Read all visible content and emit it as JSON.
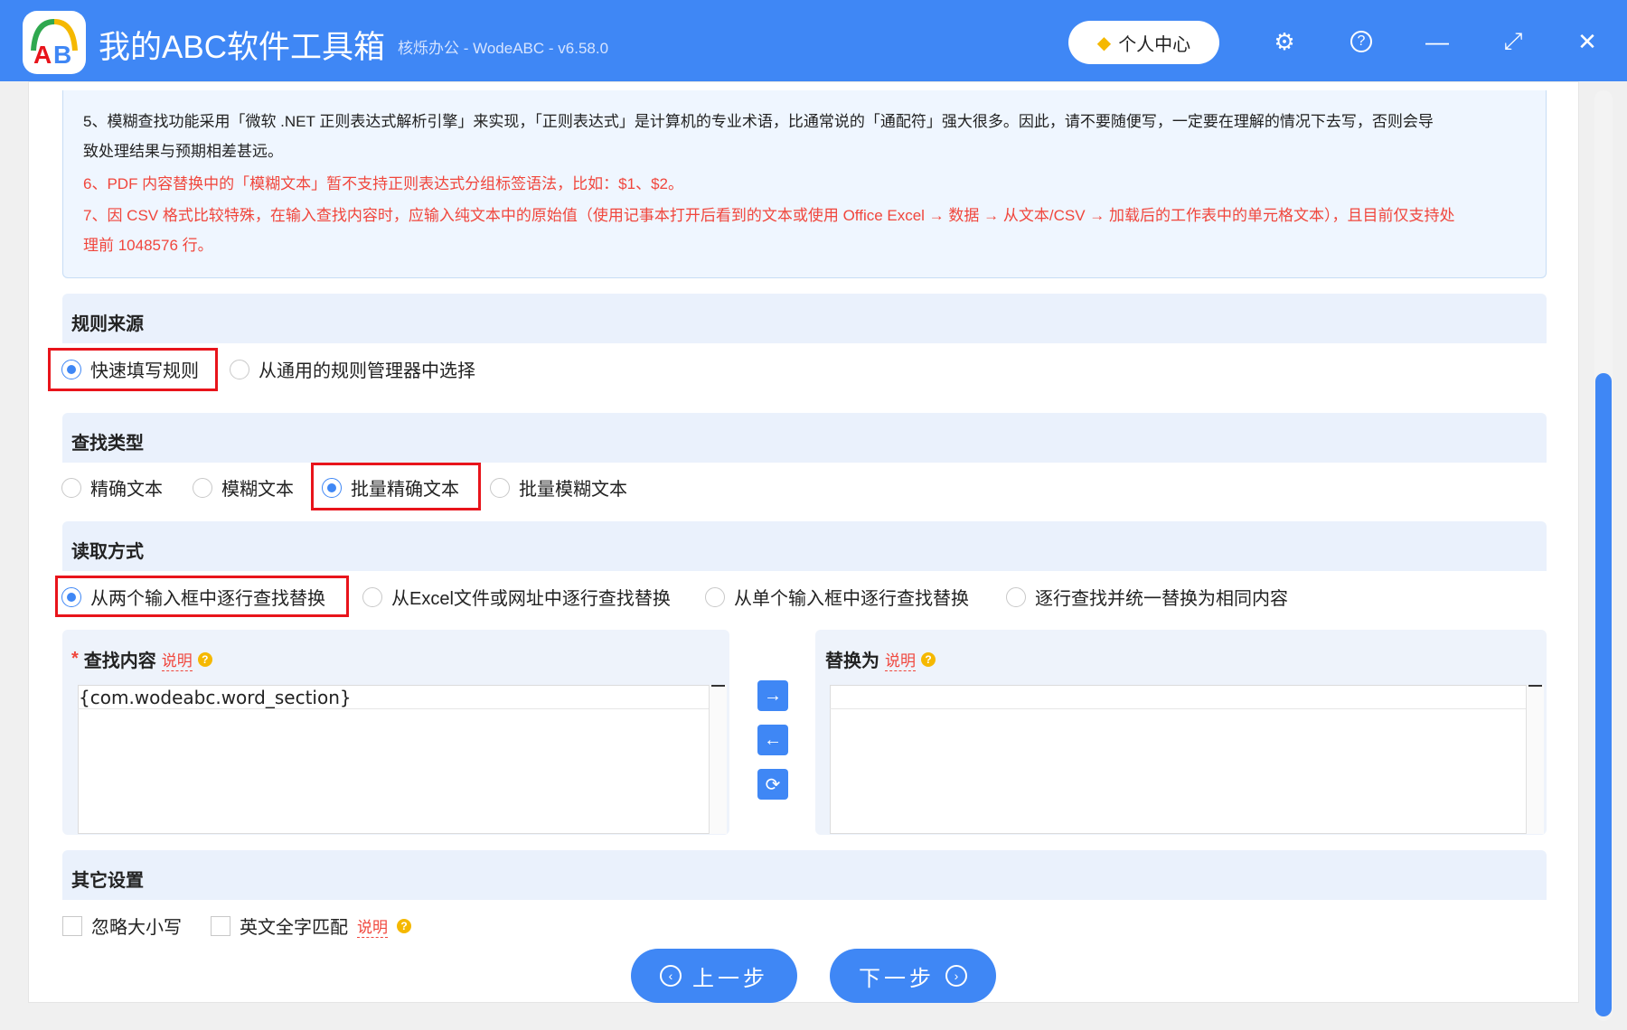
{
  "app": {
    "title": "我的ABC软件工具箱",
    "subtitle": "核烁办公 - WodeABC - v6.58.0",
    "user_center": "个人中心",
    "accent": "#3f87f5"
  },
  "info": {
    "lines": [
      "5、模糊查找功能采用「微软 .NET 正则表达式解析引擎」来实现，「正则表达式」是计算机的专业术语，比通常说的「通配符」强大很多。因此，请不要随便写，一定要在理解的情况下去写，否则会导",
      "致处理结果与预期相差甚远。",
      "6、PDF 内容替换中的「模糊文本」暂不支持正则表达式分组标签语法，比如：$1、$2。",
      "7、因 CSV 格式比较特殊，在输入查找内容时，应输入纯文本中的原始值（使用记事本打开后看到的文本或使用 Office Excel → 数据 → 从文本/CSV → 加载后的工作表中的单元格文本），且目前仅支持处",
      "理前 1048576 行。"
    ]
  },
  "rule_source": {
    "title": "规则来源",
    "options": [
      "快速填写规则",
      "从通用的规则管理器中选择"
    ],
    "selected": 0
  },
  "find_type": {
    "title": "查找类型",
    "options": [
      "精确文本",
      "模糊文本",
      "批量精确文本",
      "批量模糊文本"
    ],
    "selected": 2
  },
  "read_mode": {
    "title": "读取方式",
    "options": [
      "从两个输入框中逐行查找替换",
      "从Excel文件或网址中逐行查找替换",
      "从单个输入框中逐行查找替换",
      "逐行查找并统一替换为相同内容"
    ],
    "selected": 0
  },
  "find": {
    "required": "*",
    "label": "查找内容",
    "help": "说明",
    "value": "{com.wodeabc.word_section}"
  },
  "replace": {
    "label": "替换为",
    "help": "说明",
    "value": ""
  },
  "other": {
    "title": "其它设置",
    "ignore_case": "忽略大小写",
    "whole_word": "英文全字匹配",
    "help": "说明",
    "ignore_case_checked": false,
    "whole_word_checked": false
  },
  "buttons": {
    "prev": "上一步",
    "next": "下一步"
  }
}
